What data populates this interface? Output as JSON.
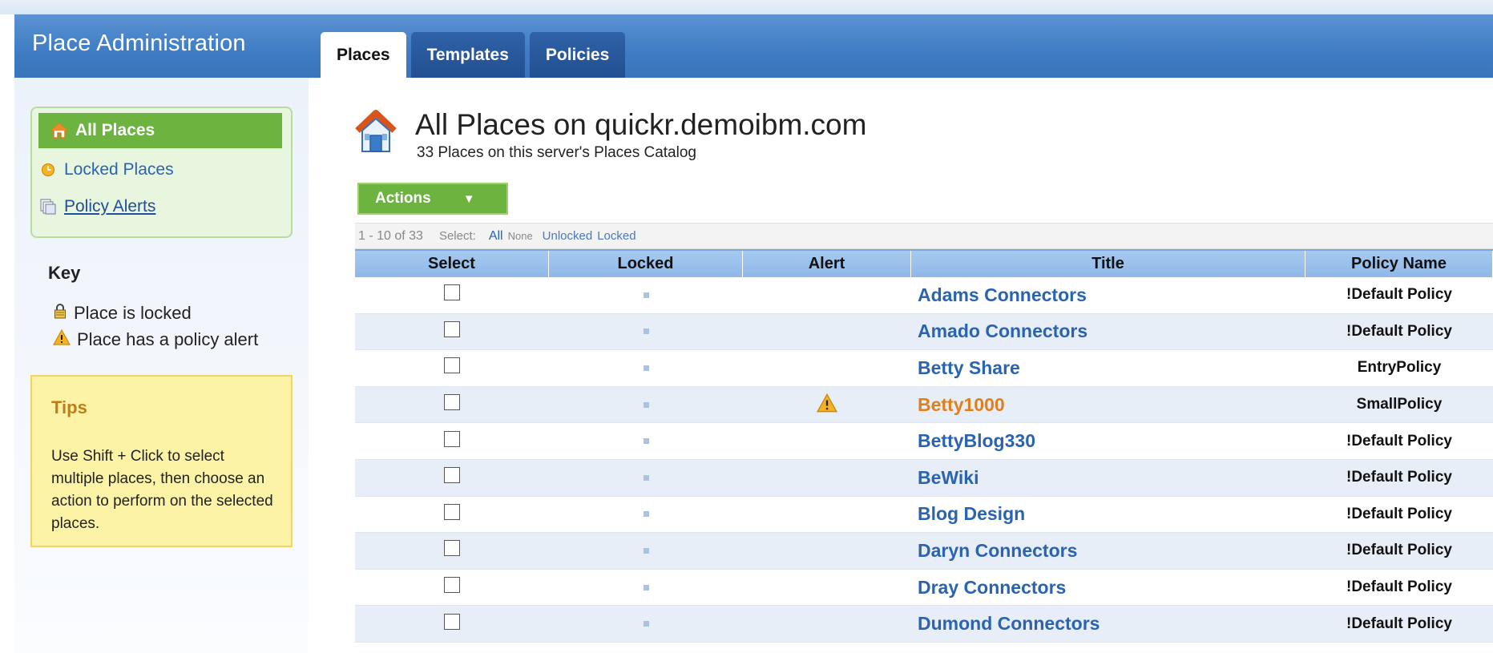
{
  "app": {
    "title": "Place Administration"
  },
  "tabs": [
    {
      "label": "Places",
      "active": true
    },
    {
      "label": "Templates",
      "active": false
    },
    {
      "label": "Policies",
      "active": false
    }
  ],
  "sidebar": {
    "items": [
      {
        "label": "All Places",
        "icon": "home-icon",
        "active": true
      },
      {
        "label": "Locked Places",
        "icon": "clock-icon",
        "active": false
      },
      {
        "label": "Policy Alerts",
        "icon": "copies-icon",
        "active": false
      }
    ],
    "key": {
      "title": "Key",
      "locked": "Place is locked",
      "alert": "Place has a policy alert"
    },
    "tips": {
      "title": "Tips",
      "body": "Use Shift + Click to select multiple places, then choose an action to perform on the selected places."
    }
  },
  "main": {
    "title": "All Places on quickr.demoibm.com",
    "subtitle": "33 Places on this server's Places Catalog",
    "actions_label": "Actions",
    "status": {
      "range": "1 - 10 of 33",
      "select_label": "Select:",
      "all": "All",
      "none": "None",
      "unlocked": "Unlocked",
      "locked": "Locked"
    },
    "columns": [
      "Select",
      "Locked",
      "Alert",
      "Title",
      "Policy Name"
    ],
    "rows": [
      {
        "title": "Adams Connectors",
        "policy": "!Default Policy",
        "alert": false
      },
      {
        "title": "Amado Connectors",
        "policy": "!Default Policy",
        "alert": false
      },
      {
        "title": "Betty Share",
        "policy": "EntryPolicy",
        "alert": false
      },
      {
        "title": "Betty1000",
        "policy": "SmallPolicy",
        "alert": true
      },
      {
        "title": "BettyBlog330",
        "policy": "!Default Policy",
        "alert": false
      },
      {
        "title": "BeWiki",
        "policy": "!Default Policy",
        "alert": false
      },
      {
        "title": "Blog Design",
        "policy": "!Default Policy",
        "alert": false
      },
      {
        "title": "Daryn Connectors",
        "policy": "!Default Policy",
        "alert": false
      },
      {
        "title": "Dray Connectors",
        "policy": "!Default Policy",
        "alert": false
      },
      {
        "title": "Dumond Connectors",
        "policy": "!Default Policy",
        "alert": false
      }
    ]
  },
  "colors": {
    "header_blue": "#3f7cc4",
    "nav_green": "#6db33f",
    "link_blue": "#2a63b0",
    "alert_orange": "#e0801c",
    "tips_yellow": "#fdf3a6"
  }
}
